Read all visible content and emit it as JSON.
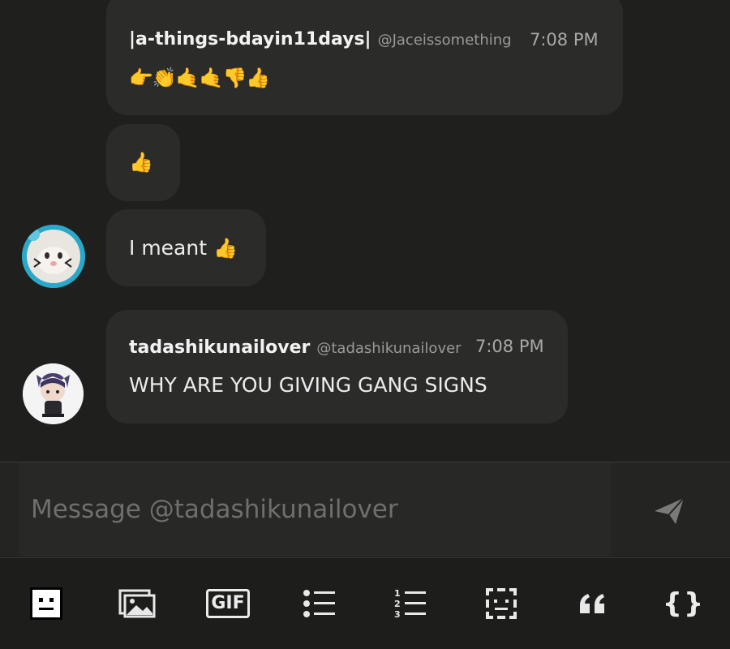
{
  "messages": [
    {
      "username": "|a-things-bdayin11days|",
      "handle": "@Jaceissomething",
      "time": "7:08 PM",
      "text": "👉👏🤙🤙👎👍"
    },
    {
      "text": "👍"
    },
    {
      "text": "I meant",
      "emoji": "👍"
    },
    {
      "username": "tadashikunailover",
      "handle": "@tadashikunailover",
      "time": "7:08 PM",
      "text": "WHY ARE YOU GIVING GANG SIGNS"
    }
  ],
  "composer": {
    "placeholder": "Message @tadashikunailover",
    "value": ""
  },
  "toolbar": {
    "gif_label": "GIF",
    "quote_label": "66",
    "code_label": "{}",
    "numbers": [
      "1",
      "2",
      "3"
    ]
  },
  "colors": {
    "background": "#1f1f1d",
    "bubble": "#2b2b29",
    "avatar_ring": "#29a8c9"
  }
}
